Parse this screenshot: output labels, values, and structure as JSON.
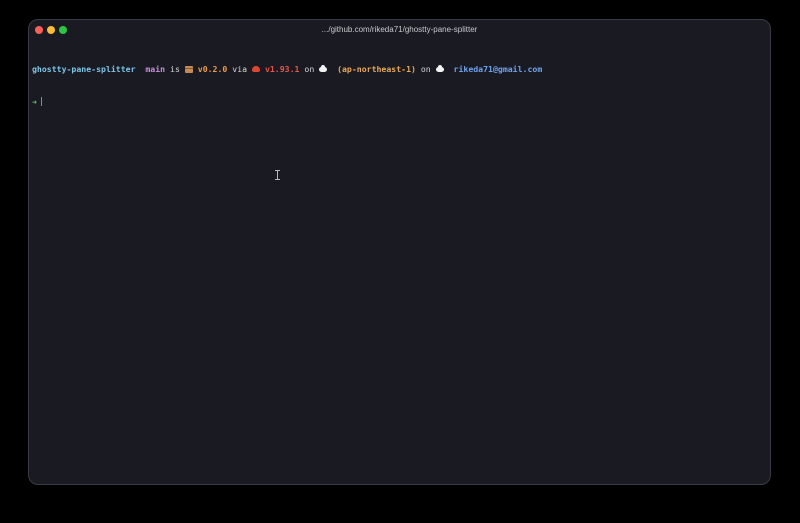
{
  "window": {
    "title": ".../github.com/rikeda71/ghostty-pane-splitter"
  },
  "prompt": {
    "directory": "ghostty-pane-splitter",
    "branch": "main",
    "word_is": "is",
    "package_version": "v0.2.0",
    "word_via": "via",
    "rust_version": "v1.93.1",
    "word_on_1": "on",
    "aws_region": "(ap-northeast-1)",
    "word_on_2": "on",
    "account_email": "rikeda71@gmail.com",
    "input_symbol": "➜",
    "input_value": ""
  },
  "icons": {
    "package": "package-icon",
    "rust": "crab-icon",
    "aws": "cloud-icon",
    "gcloud": "cloud-icon"
  },
  "colors": {
    "window_bg": "#1a1a22",
    "directory": "#7dc6e8",
    "branch": "#c58ed8",
    "version": "#f09a3e",
    "rust": "#e8534a",
    "region": "#e8a952",
    "email": "#6da2ee",
    "prompt_arrow": "#5fd068"
  }
}
